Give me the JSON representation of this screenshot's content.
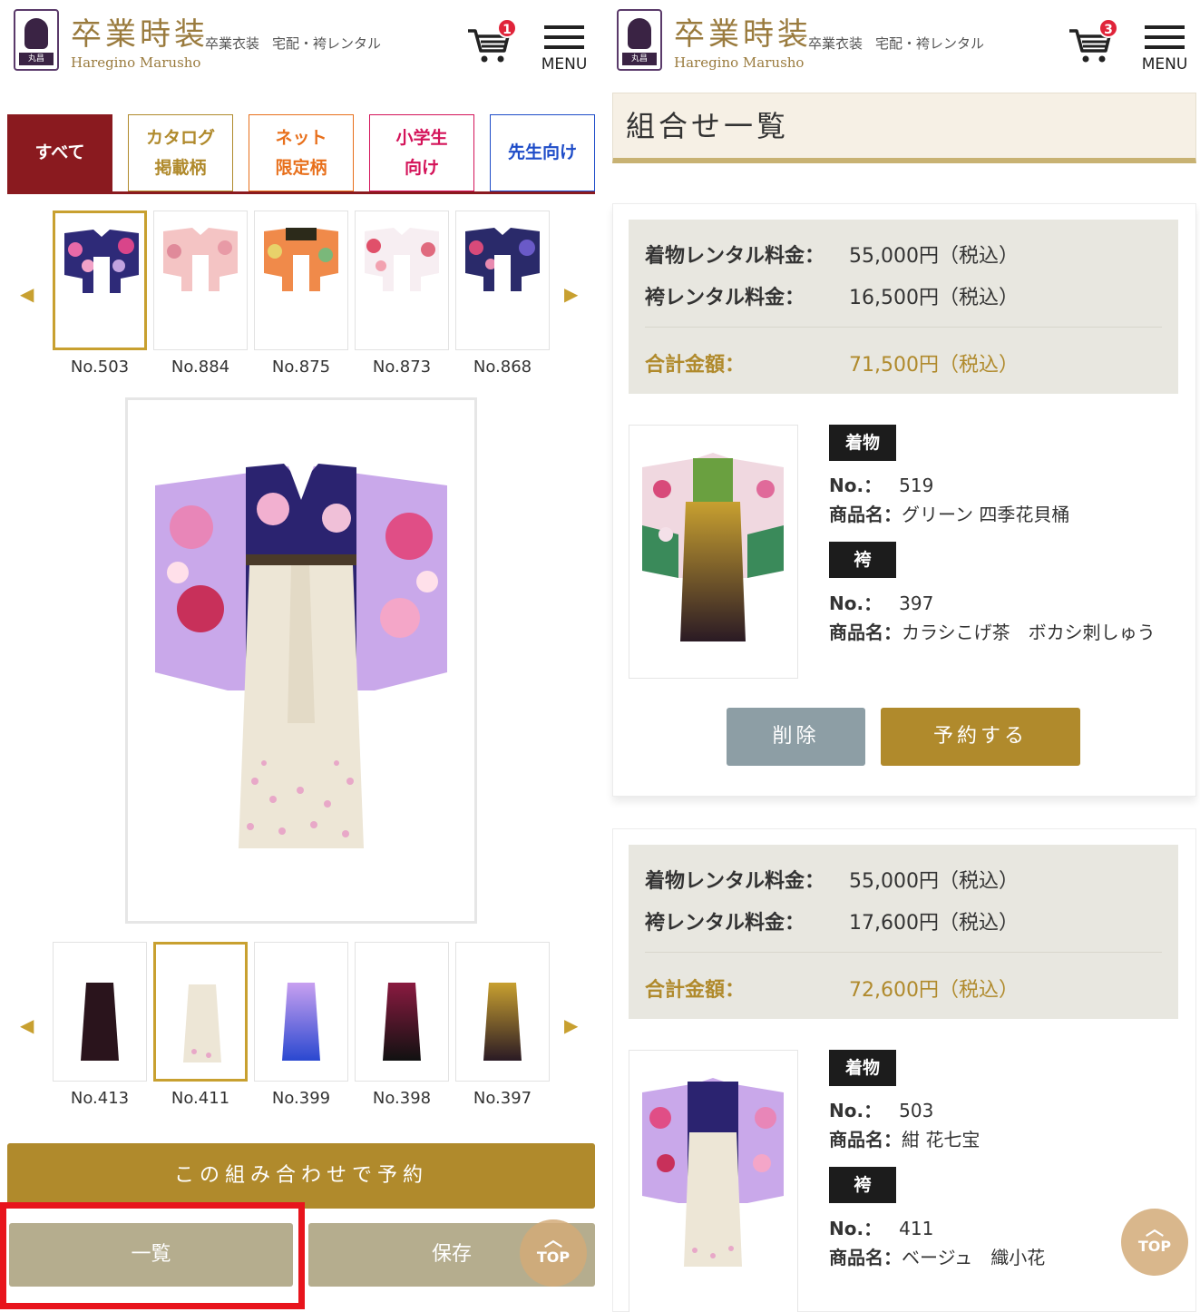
{
  "header": {
    "brand": "卒業時装",
    "brand_sub": "Haregino Marusho",
    "logo_text": "丸昌",
    "nav": [
      "卒業衣装",
      "宅配・袴レンタル"
    ],
    "menu_label": "MENU"
  },
  "left": {
    "cart_count": "1",
    "tabs": [
      {
        "label": "すべて",
        "color": "#8a1a1f"
      },
      {
        "label": "カタログ\n掲載柄",
        "color": "#b08a2c"
      },
      {
        "label": "ネット\n限定柄",
        "color": "#e8701c"
      },
      {
        "label": "小学生\n向け",
        "color": "#d4145a"
      },
      {
        "label": "先生向け",
        "color": "#1e4cc8"
      }
    ],
    "kimono_items": [
      "No.503",
      "No.884",
      "No.875",
      "No.873",
      "No.868"
    ],
    "hakama_items": [
      "No.413",
      "No.411",
      "No.399",
      "No.398",
      "No.397"
    ],
    "reserve_label": "この組み合わせで予約",
    "list_label": "一覧",
    "save_label": "保存",
    "top_label": "TOP"
  },
  "right": {
    "cart_count": "3",
    "list_title": "組合せ一覧",
    "cards": [
      {
        "kimono_fee_label": "着物レンタル料金：",
        "kimono_fee": "55,000円（税込）",
        "hakama_fee_label": "袴レンタル料金：",
        "hakama_fee": "16,500円（税込）",
        "total_label": "合計金額：",
        "total": "71,500円（税込）",
        "kimono_tag": "着物",
        "kimono_no_label": "No.：",
        "kimono_no": "519",
        "kimono_name_label": "商品名：",
        "kimono_name": "グリーン 四季花貝桶",
        "hakama_tag": "袴",
        "hakama_no_label": "No.：",
        "hakama_no": "397",
        "hakama_name_label": "商品名：",
        "hakama_name": "カラシこげ茶　ボカシ刺しゅう",
        "delete_label": "削除",
        "book_label": "予約する"
      },
      {
        "kimono_fee_label": "着物レンタル料金：",
        "kimono_fee": "55,000円（税込）",
        "hakama_fee_label": "袴レンタル料金：",
        "hakama_fee": "17,600円（税込）",
        "total_label": "合計金額：",
        "total": "72,600円（税込）",
        "kimono_tag": "着物",
        "kimono_no_label": "No.：",
        "kimono_no": "503",
        "kimono_name_label": "商品名：",
        "kimono_name": "紺 花七宝",
        "hakama_tag": "袴",
        "hakama_no_label": "No.：",
        "hakama_no": "411",
        "hakama_name_label": "商品名：",
        "hakama_name": "ベージュ　織小花"
      }
    ],
    "top_label": "TOP"
  }
}
